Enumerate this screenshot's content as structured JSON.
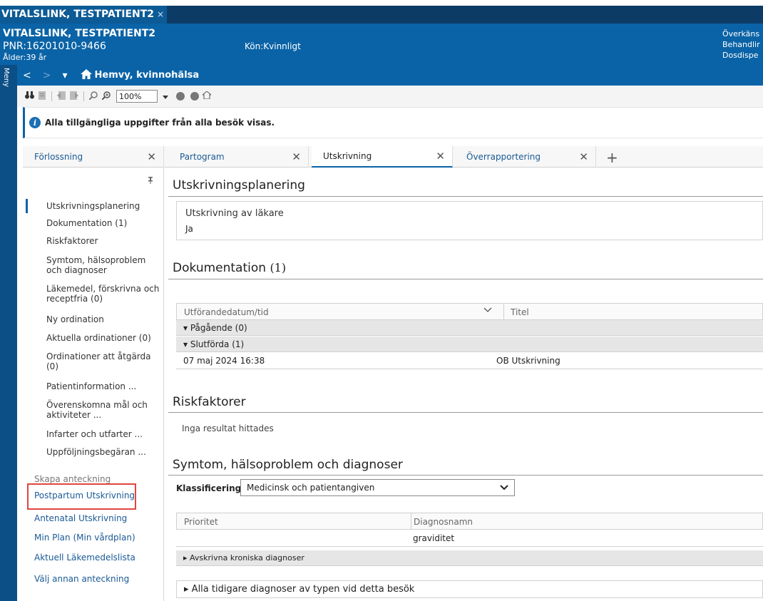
{
  "titlebar": {
    "tab_label": "VITALSLINK, TESTPATIENT2",
    "tab_close": "×"
  },
  "banner": {
    "name": "VITALSLINK, TESTPATIENT2",
    "pnr": "PNR:16201010-9466",
    "age": "Ålder:39 år",
    "sex": "Kön:Kvinnligt",
    "right_lines": [
      "Överkäns",
      "Behandlir",
      "Dosdispe"
    ]
  },
  "leftrail": {
    "label": "Meny"
  },
  "navbar": {
    "back": "<",
    "forward": ">",
    "dropdown": "▾",
    "title": "Hemvy, kvinnohälsa"
  },
  "toolbar": {
    "zoom": "100%"
  },
  "infobar": {
    "text": "Alla tillgängliga uppgifter från alla besök visas."
  },
  "tabs": [
    {
      "label": "Förlossning",
      "active": false
    },
    {
      "label": "Partogram",
      "active": false
    },
    {
      "label": "Utskrivning",
      "active": true
    },
    {
      "label": "Överrapportering",
      "active": false
    }
  ],
  "sidebar": {
    "items": [
      "Utskrivningsplanering",
      "Dokumentation (1)",
      "Riskfaktorer",
      "Symtom, hälsoproblem och diagnoser",
      "Läkemedel, förskrivna och receptfria (0)",
      "Ny ordination",
      "Aktuella ordinationer (0)",
      "Ordinationer att åtgärda (0)",
      "Patientinformation ...",
      "Överenskomna mål och aktiviteter ...",
      "Infarter och utfarter ...",
      "Uppföljningsbegäran ..."
    ],
    "create_note_label": "Skapa anteckning",
    "links": [
      "Postpartum Utskrivning",
      "Antenatal Utskrivning",
      "Min Plan (Min vårdplan)",
      "Aktuell Läkemedelslista",
      "Välj annan anteckning"
    ]
  },
  "main": {
    "utskrivningsplanering": {
      "title": "Utskrivningsplanering",
      "field_label": "Utskrivning av läkare",
      "field_value": "Ja"
    },
    "dokumentation": {
      "title": "Dokumentation",
      "count": "(1)",
      "columns": [
        "Utförandedatum/tid",
        "Titel"
      ],
      "groups": [
        "Pågående (0)",
        "Slutförda (1)"
      ],
      "rows": [
        {
          "date": "07 maj 2024 16:38",
          "title": "OB Utskrivning"
        }
      ]
    },
    "riskfaktorer": {
      "title": "Riskfaktorer",
      "empty": "Inga resultat hittades"
    },
    "symtom": {
      "title": "Symtom, hälsoproblem och diagnoser",
      "classification_label": "Klassificering",
      "classification_value": "Medicinsk och patientangiven",
      "columns": [
        "Prioritet",
        "Diagnosnamn"
      ],
      "rows": [
        {
          "priority": "",
          "name": "graviditet"
        }
      ],
      "group": "Avskrivna kroniska diagnoser",
      "all_previous": "Alla tidigare diagnoser av typen vid detta besök"
    }
  },
  "colors": {
    "brand_dark": "#0c3c66",
    "brand": "#0a63a6",
    "link": "#1a5a95",
    "highlight": "#e0463f"
  }
}
